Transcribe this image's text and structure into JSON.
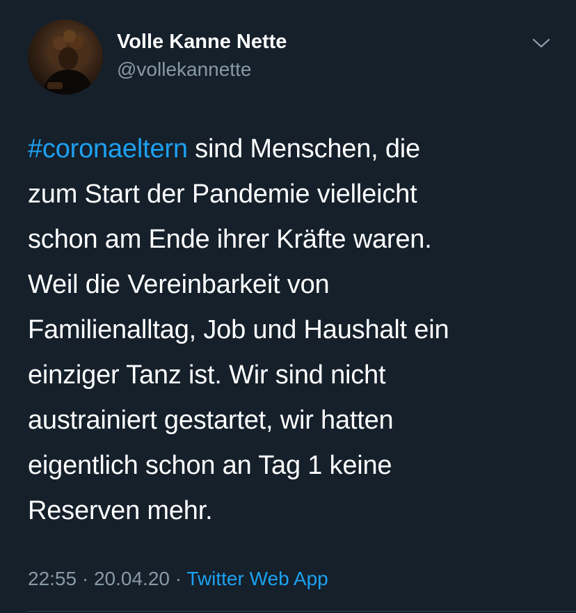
{
  "author": {
    "display_name": "Volle Kanne Nette",
    "handle": "@vollekannette"
  },
  "tweet": {
    "hashtag": "#coronaeltern",
    "lines": [
      " sind Menschen, die",
      "zum Start der Pandemie vielleicht",
      "schon am Ende ihrer Kräfte waren.",
      "Weil die Vereinbarkeit von",
      "Familienalltag, Job und Haushalt ein",
      "einziger Tanz ist. Wir sind nicht",
      "austrainiert gestartet, wir hatten",
      "eigentlich schon an Tag 1 keine",
      "Reserven mehr."
    ]
  },
  "meta": {
    "time": "22:55",
    "separator": " · ",
    "date": "20.04.20",
    "source": "Twitter Web App"
  },
  "colors": {
    "background": "#15202b",
    "text": "#ffffff",
    "secondary": "#8899a6",
    "accent": "#1da1f2"
  },
  "icons": {
    "avatar": "profile-photo",
    "menu": "chevron-down-icon"
  }
}
